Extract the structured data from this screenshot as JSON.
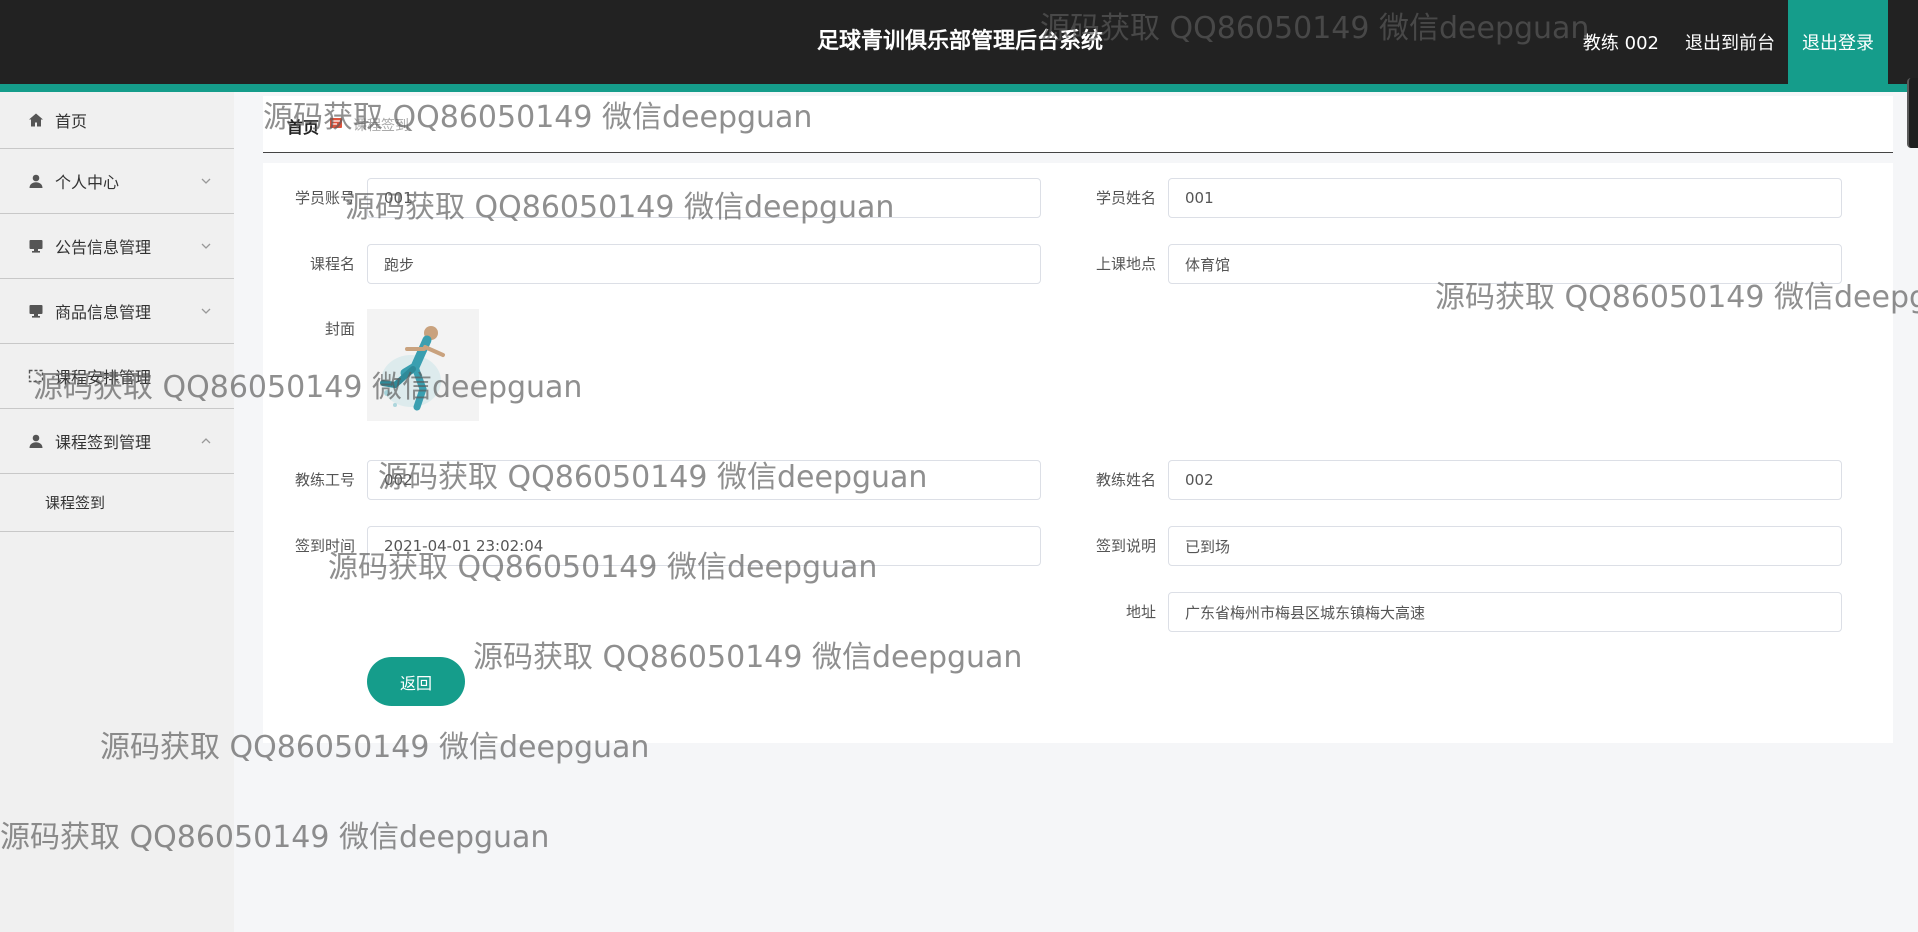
{
  "header": {
    "title": "足球青训俱乐部管理后台系统",
    "user": "教练 002",
    "front_label": "退出到前台",
    "logout_label": "退出登录"
  },
  "sidebar": {
    "items": [
      {
        "label": "首页",
        "icon": "home-icon"
      },
      {
        "label": "个人中心",
        "icon": "user-icon"
      },
      {
        "label": "公告信息管理",
        "icon": "monitor-icon"
      },
      {
        "label": "商品信息管理",
        "icon": "monitor-icon"
      },
      {
        "label": "课程安排管理",
        "icon": "image-icon"
      },
      {
        "label": "课程签到管理",
        "icon": "user-icon"
      }
    ],
    "submenu": {
      "label": "课程签到"
    }
  },
  "breadcrumb": {
    "home": "首页",
    "current": "课程签到"
  },
  "form": {
    "student_account": {
      "label": "学员账号",
      "value": "001"
    },
    "student_name": {
      "label": "学员姓名",
      "value": "001"
    },
    "course_name": {
      "label": "课程名",
      "value": "跑步"
    },
    "location": {
      "label": "上课地点",
      "value": "体育馆"
    },
    "cover": {
      "label": "封面"
    },
    "coach_id": {
      "label": "教练工号",
      "value": "002"
    },
    "coach_name": {
      "label": "教练姓名",
      "value": "002"
    },
    "signin_time": {
      "label": "签到时间",
      "value": "2021-04-01 23:02:04"
    },
    "signin_note": {
      "label": "签到说明",
      "value": "已到场"
    },
    "address": {
      "label": "地址",
      "value": "广东省梅州市梅县区城东镇梅大高速"
    },
    "back_label": "返回"
  },
  "watermark": "源码获取 QQ86050149 微信deepguan",
  "colors": {
    "accent": "#159d8b",
    "header_bg": "#222222",
    "sidebar_bg": "#f0f0f0"
  }
}
